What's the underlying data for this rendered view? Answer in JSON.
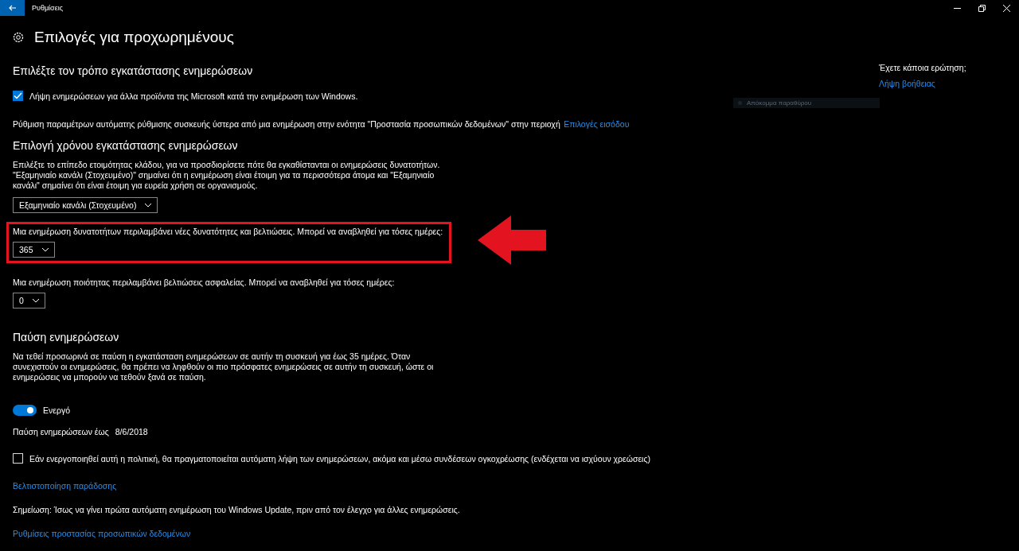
{
  "window": {
    "title": "Ρυθμίσεις"
  },
  "page": {
    "title": "Επιλογές για προχωρημένους"
  },
  "install_method": {
    "heading": "Επιλέξτε τον τρόπο εγκατάστασης ενημερώσεων",
    "checkbox": {
      "label": "Λήψη ενημερώσεων για άλλα προϊόντα της Microsoft κατά την ενημέρωση των Windows.",
      "checked": true
    },
    "note": {
      "text": "Ρύθμιση παραμέτρων αυτόματης ρύθμισης συσκευής ύστερα από μια ενημέρωση στην ενότητα \"Προστασία προσωπικών δεδομένων\" στην περιοχή",
      "link": "Επιλογές εισόδου"
    }
  },
  "install_time": {
    "heading": "Επιλογή χρόνου εγκατάστασης ενημερώσεων",
    "description": "Επιλέξτε το επίπεδο ετοιμότητας κλάδου, για να προσδιορίσετε πότε θα εγκαθίστανται οι ενημερώσεις δυνατοτήτων. \"Εξαμηνιαίο κανάλι (Στοχευμένο)\" σημαίνει ότι η ενημέρωση είναι έτοιμη για τα περισσότερα άτομα και \"Εξαμηνιαίο κανάλι\" σημαίνει ότι είναι έτοιμη για ευρεία χρήση σε οργανισμούς.",
    "branch": {
      "value": "Εξαμηνιαίο κανάλι (Στοχευμένο)"
    },
    "deferrals": [
      {
        "label": "Μια ενημέρωση δυνατοτήτων περιλαμβάνει νέες δυνατότητες και βελτιώσεις. Μπορεί να αναβληθεί για τόσες ημέρες:",
        "value": "365",
        "highlighted": true
      },
      {
        "label": "Μια ενημέρωση ποιότητας περιλαμβάνει βελτιώσεις ασφαλείας. Μπορεί να αναβληθεί για τόσες ημέρες:",
        "value": "0",
        "highlighted": false
      }
    ]
  },
  "pause": {
    "heading": "Παύση ενημερώσεων",
    "description": "Να τεθεί προσωρινά σε παύση η εγκατάσταση ενημερώσεων σε αυτήν τη συσκευή για έως 35 ημέρες. Όταν συνεχιστούν οι ενημερώσεις, θα πρέπει να ληφθούν οι πιο πρόσφατες ενημερώσεις σε αυτήν τη συσκευή, ώστε οι ενημερώσεις να μπορούν να τεθούν ξανά σε παύση.",
    "toggle": {
      "label": "Ενεργό",
      "on": true
    },
    "until": {
      "label": "Παύση ενημερώσεων έως",
      "date": "8/6/2018"
    }
  },
  "metered": {
    "label": "Εάν ενεργοποιηθεί αυτή η πολιτική, θα πραγματοποιείται αυτόματη λήψη των ενημερώσεων, ακόμα και μέσω συνδέσεων ογκοχρέωσης (ενδέχεται να ισχύουν χρεώσεις)",
    "checked": false
  },
  "footer": [
    {
      "kind": "link",
      "text": "Βελτιστοποίηση παράδοσης"
    },
    {
      "kind": "note",
      "text": "Σημείωση: Ίσως να γίνει πρώτα αυτόματη ενημέρωση του Windows Update, πριν από τον έλεγχο για άλλες ενημερώσεις."
    },
    {
      "kind": "link",
      "text": "Ρυθμίσεις προστασίας προσωπικών δεδομένων"
    }
  ],
  "sidebar": {
    "question": "Έχετε κάποια ερώτηση;",
    "link": "Λήψη βοήθειας"
  },
  "snip_hint": {
    "text": "Απόκομμα παραθύρου"
  }
}
